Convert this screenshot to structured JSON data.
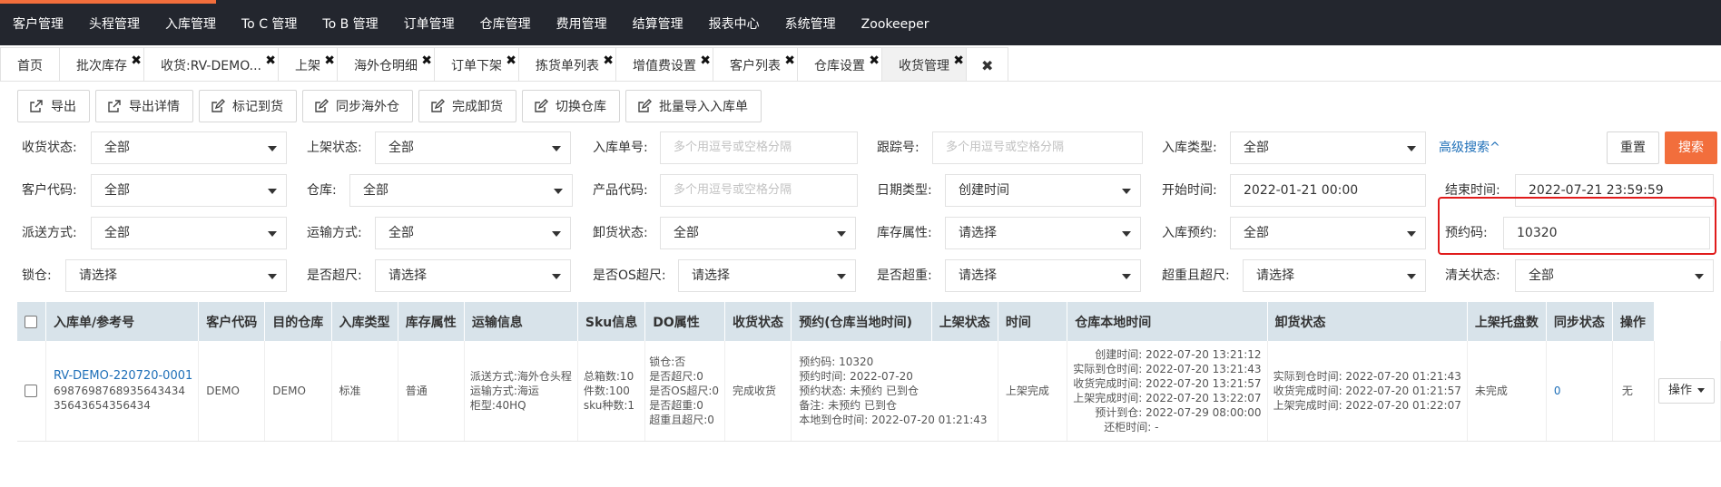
{
  "topnav": {
    "items": [
      "客户管理",
      "头程管理",
      "入库管理",
      "To C 管理",
      "To B 管理",
      "订单管理",
      "仓库管理",
      "费用管理",
      "结算管理",
      "报表中心",
      "系统管理",
      "Zookeeper"
    ],
    "accent_color": "#f26e3c",
    "bg_color": "#23262e"
  },
  "tabs": [
    {
      "label": "首页",
      "closable": false
    },
    {
      "label": "批次库存",
      "closable": true
    },
    {
      "label": "收货:RV-DEMO...",
      "closable": true
    },
    {
      "label": "上架",
      "closable": true
    },
    {
      "label": "海外仓明细",
      "closable": true
    },
    {
      "label": "订单下架",
      "closable": true
    },
    {
      "label": "拣货单列表",
      "closable": true
    },
    {
      "label": "增值费设置",
      "closable": true
    },
    {
      "label": "客户列表",
      "closable": true
    },
    {
      "label": "仓库设置",
      "closable": true
    },
    {
      "label": "收货管理",
      "closable": true,
      "active": true
    }
  ],
  "close_all_glyph": "✖",
  "close_glyph": "✖",
  "toolbar": [
    {
      "label": "导出",
      "icon": "export-icon"
    },
    {
      "label": "导出详情",
      "icon": "export-icon"
    },
    {
      "label": "标记到货",
      "icon": "edit-icon"
    },
    {
      "label": "同步海外仓",
      "icon": "edit-icon"
    },
    {
      "label": "完成卸货",
      "icon": "edit-icon"
    },
    {
      "label": "切换仓库",
      "icon": "edit-icon"
    },
    {
      "label": "批量导入入库单",
      "icon": "edit-icon"
    }
  ],
  "filters": {
    "receipt_status": {
      "label": "收货状态:",
      "value": "全部"
    },
    "shelf_status": {
      "label": "上架状态:",
      "value": "全部"
    },
    "inbound_no": {
      "label": "入库单号:",
      "placeholder": "多个用逗号或空格分隔"
    },
    "tracking_no": {
      "label": "跟踪号:",
      "placeholder": "多个用逗号或空格分隔"
    },
    "inbound_type": {
      "label": "入库类型:",
      "value": "全部"
    },
    "advanced_search": "高级搜索^",
    "reset": "重置",
    "search": "搜索",
    "customer_code": {
      "label": "客户代码:",
      "value": "全部"
    },
    "warehouse": {
      "label": "仓库:",
      "value": "全部"
    },
    "product_code": {
      "label": "产品代码:",
      "placeholder": "多个用逗号或空格分隔"
    },
    "date_type": {
      "label": "日期类型:",
      "value": "创建时间"
    },
    "start_time": {
      "label": "开始时间:",
      "value": "2022-01-21 00:00"
    },
    "end_time": {
      "label": "结束时间:",
      "value": "2022-07-21 23:59:59"
    },
    "delivery_method": {
      "label": "派送方式:",
      "value": "全部"
    },
    "transport_method": {
      "label": "运输方式:",
      "value": "全部"
    },
    "unload_status": {
      "label": "卸货状态:",
      "value": "全部"
    },
    "stock_attr": {
      "label": "库存属性:",
      "value": "请选择"
    },
    "inbound_appointment": {
      "label": "入库预约:",
      "value": "全部"
    },
    "appointment_code": {
      "label": "预约码:",
      "value": "10320"
    },
    "lock_warehouse": {
      "label": "锁仓:",
      "value": "请选择"
    },
    "oversize": {
      "label": "是否超尺:",
      "value": "请选择"
    },
    "os_oversize": {
      "label": "是否OS超尺:",
      "value": "请选择"
    },
    "overweight": {
      "label": "是否超重:",
      "value": "请选择"
    },
    "overweight_oversize": {
      "label": "超重且超尺:",
      "value": "请选择"
    },
    "customs_status": {
      "label": "清关状态:",
      "value": "全部"
    }
  },
  "table": {
    "columns": [
      "入库单/参考号",
      "客户代码",
      "目的仓库",
      "入库类型",
      "库存属性",
      "运输信息",
      "Sku信息",
      "DO属性",
      "收货状态",
      "预约(仓库当地时间)",
      "上架状态",
      "时间",
      "仓库本地时间",
      "卸货状态",
      "上架托盘数",
      "同步状态",
      "操作"
    ],
    "rows": [
      {
        "order_no": "RV-DEMO-220720-0001",
        "ref_no_1": "6987698768935643434",
        "ref_no_2": "35643654356434",
        "customer_code": "DEMO",
        "dest_warehouse": "DEMO",
        "inbound_type": "标准",
        "stock_attr": "普通",
        "transport": [
          "派送方式:海外仓头程",
          "运输方式:海运",
          "柜型:40HQ"
        ],
        "sku": [
          "总箱数:10",
          "件数:100",
          "sku种数:1"
        ],
        "do_attr": [
          "锁仓:否",
          "是否超尺:0",
          "是否OS超尺:0",
          "是否超重:0",
          "超重且超尺:0"
        ],
        "receipt_status": "完成收货",
        "appointment": [
          "预约码: 10320",
          "预约时间: 2022-07-20",
          "预约状态: 未预约 已到仓",
          "备注: 未预约 已到仓",
          "本地到仓时间: 2022-07-20 01:21:43"
        ],
        "shelf_status": "上架完成",
        "times": [
          "创建时间: 2022-07-20 13:21:12",
          "实际到仓时间: 2022-07-20 13:21:43",
          "收货完成时间: 2022-07-20 13:21:57",
          "上架完成时间: 2022-07-20 13:22:07",
          "预计到仓: 2022-07-29 08:00:00",
          "还柜时间: -"
        ],
        "local_times": [
          "实际到仓时间: 2022-07-20 01:21:43",
          "收货完成时间: 2022-07-20 01:21:57",
          "上架完成时间: 2022-07-20 01:22:07"
        ],
        "unload_status": "未完成",
        "pallets": "0",
        "sync_status": "无",
        "action": "操作"
      }
    ]
  }
}
